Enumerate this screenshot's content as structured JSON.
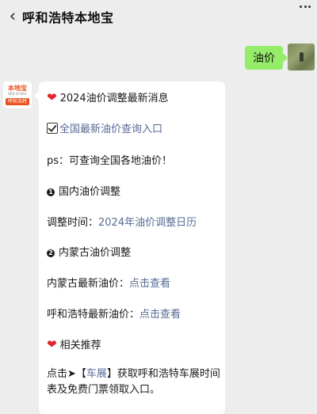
{
  "header": {
    "title": "呼和浩特本地宝"
  },
  "user_message": {
    "text": "油价"
  },
  "bot_avatar": {
    "brand": "本地宝",
    "sub": "BEN DI BAO",
    "city": "呼和浩特"
  },
  "bot_message": {
    "headline": "2024油价调整最新消息",
    "query_link": "全国最新油价查询入口",
    "ps": "ps：可查询全国各地油价！",
    "section1_title": "国内油价调整",
    "adjust_label": "调整时间：",
    "adjust_link": "2024年油价调整日历",
    "section2_title": "内蒙古油价调整",
    "nmg_label": "内蒙古最新油价：",
    "nmg_link": "点击查看",
    "hhht_label": "呼和浩特最新油价：",
    "hhht_link": "点击查看",
    "related_title": "相关推荐",
    "promo_prefix": "点击➤【",
    "promo_link": "车展",
    "promo_suffix": "】获取呼和浩特车展时间表及免费门票领取入口。"
  },
  "colors": {
    "user_bubble": "#95ec69",
    "link": "#576b95",
    "heart": "#e0262c",
    "brand": "#e8501c"
  }
}
